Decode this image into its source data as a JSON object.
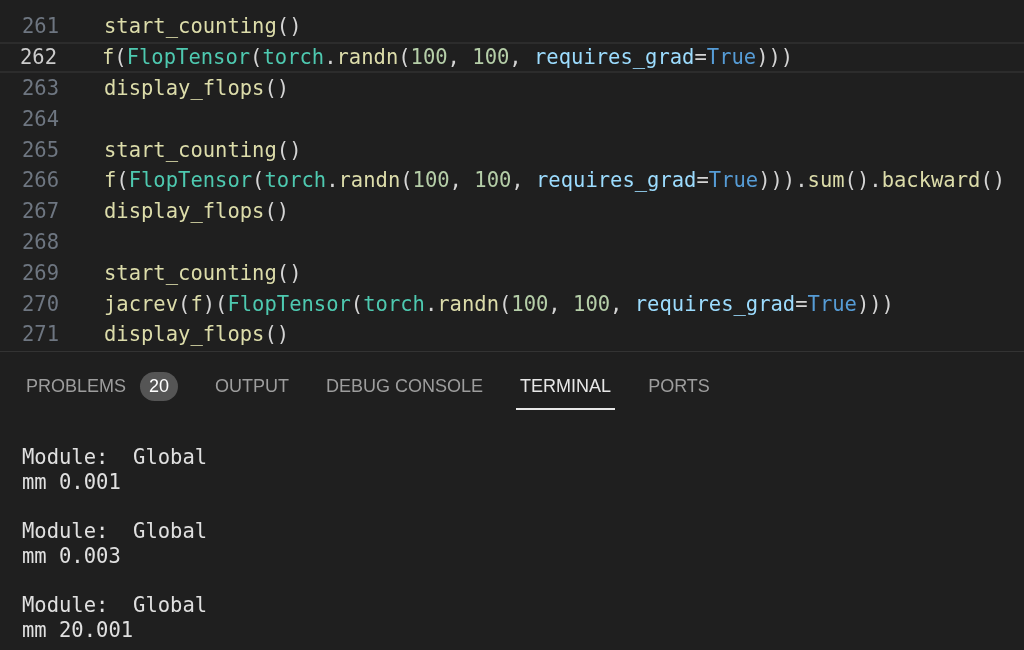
{
  "editor": {
    "lines": [
      {
        "number": "261",
        "current": false,
        "tokens": [
          {
            "kind": "fn",
            "text": "start_counting"
          },
          {
            "kind": "punc",
            "text": "()"
          }
        ]
      },
      {
        "number": "262",
        "current": true,
        "tokens": [
          {
            "kind": "fn",
            "text": "f"
          },
          {
            "kind": "punc",
            "text": "("
          },
          {
            "kind": "cls",
            "text": "FlopTensor"
          },
          {
            "kind": "punc",
            "text": "("
          },
          {
            "kind": "cls",
            "text": "torch"
          },
          {
            "kind": "punc",
            "text": "."
          },
          {
            "kind": "fn",
            "text": "randn"
          },
          {
            "kind": "punc",
            "text": "("
          },
          {
            "kind": "num",
            "text": "100"
          },
          {
            "kind": "punc",
            "text": ", "
          },
          {
            "kind": "num",
            "text": "100"
          },
          {
            "kind": "punc",
            "text": ", "
          },
          {
            "kind": "param",
            "text": "requires_grad"
          },
          {
            "kind": "punc",
            "text": "="
          },
          {
            "kind": "kw",
            "text": "True"
          },
          {
            "kind": "punc",
            "text": ")))"
          }
        ]
      },
      {
        "number": "263",
        "current": false,
        "tokens": [
          {
            "kind": "fn",
            "text": "display_flops"
          },
          {
            "kind": "punc",
            "text": "()"
          }
        ]
      },
      {
        "number": "264",
        "current": false
      },
      {
        "number": "265",
        "current": false,
        "tokens": [
          {
            "kind": "fn",
            "text": "start_counting"
          },
          {
            "kind": "punc",
            "text": "()"
          }
        ]
      },
      {
        "number": "266",
        "current": false,
        "tokens": [
          {
            "kind": "fn",
            "text": "f"
          },
          {
            "kind": "punc",
            "text": "("
          },
          {
            "kind": "cls",
            "text": "FlopTensor"
          },
          {
            "kind": "punc",
            "text": "("
          },
          {
            "kind": "cls",
            "text": "torch"
          },
          {
            "kind": "punc",
            "text": "."
          },
          {
            "kind": "fn",
            "text": "randn"
          },
          {
            "kind": "punc",
            "text": "("
          },
          {
            "kind": "num",
            "text": "100"
          },
          {
            "kind": "punc",
            "text": ", "
          },
          {
            "kind": "num",
            "text": "100"
          },
          {
            "kind": "punc",
            "text": ", "
          },
          {
            "kind": "param",
            "text": "requires_grad"
          },
          {
            "kind": "punc",
            "text": "="
          },
          {
            "kind": "kw",
            "text": "True"
          },
          {
            "kind": "punc",
            "text": ")))."
          },
          {
            "kind": "fn",
            "text": "sum"
          },
          {
            "kind": "punc",
            "text": "()."
          },
          {
            "kind": "fn",
            "text": "backward"
          },
          {
            "kind": "punc",
            "text": "()"
          }
        ]
      },
      {
        "number": "267",
        "current": false,
        "tokens": [
          {
            "kind": "fn",
            "text": "display_flops"
          },
          {
            "kind": "punc",
            "text": "()"
          }
        ]
      },
      {
        "number": "268",
        "current": false
      },
      {
        "number": "269",
        "current": false,
        "tokens": [
          {
            "kind": "fn",
            "text": "start_counting"
          },
          {
            "kind": "punc",
            "text": "()"
          }
        ]
      },
      {
        "number": "270",
        "current": false,
        "tokens": [
          {
            "kind": "fn",
            "text": "jacrev"
          },
          {
            "kind": "punc",
            "text": "("
          },
          {
            "kind": "fn",
            "text": "f"
          },
          {
            "kind": "punc",
            "text": ")("
          },
          {
            "kind": "cls",
            "text": "FlopTensor"
          },
          {
            "kind": "punc",
            "text": "("
          },
          {
            "kind": "cls",
            "text": "torch"
          },
          {
            "kind": "punc",
            "text": "."
          },
          {
            "kind": "fn",
            "text": "randn"
          },
          {
            "kind": "punc",
            "text": "("
          },
          {
            "kind": "num",
            "text": "100"
          },
          {
            "kind": "punc",
            "text": ", "
          },
          {
            "kind": "num",
            "text": "100"
          },
          {
            "kind": "punc",
            "text": ", "
          },
          {
            "kind": "param",
            "text": "requires_grad"
          },
          {
            "kind": "punc",
            "text": "="
          },
          {
            "kind": "kw",
            "text": "True"
          },
          {
            "kind": "punc",
            "text": ")))"
          }
        ]
      },
      {
        "number": "271",
        "current": false,
        "tokens": [
          {
            "kind": "fn",
            "text": "display_flops"
          },
          {
            "kind": "punc",
            "text": "()"
          }
        ]
      }
    ]
  },
  "panel": {
    "tabs": [
      {
        "label": "PROBLEMS",
        "selected": false,
        "badge": "20"
      },
      {
        "label": "OUTPUT",
        "selected": false
      },
      {
        "label": "DEBUG CONSOLE",
        "selected": false
      },
      {
        "label": "TERMINAL",
        "selected": true
      },
      {
        "label": "PORTS",
        "selected": false
      }
    ]
  },
  "terminal": {
    "blocks": [
      [
        "Module:  Global",
        "mm 0.001"
      ],
      [
        "Module:  Global",
        "mm 0.003"
      ],
      [
        "Module:  Global",
        "mm 20.001"
      ]
    ]
  }
}
